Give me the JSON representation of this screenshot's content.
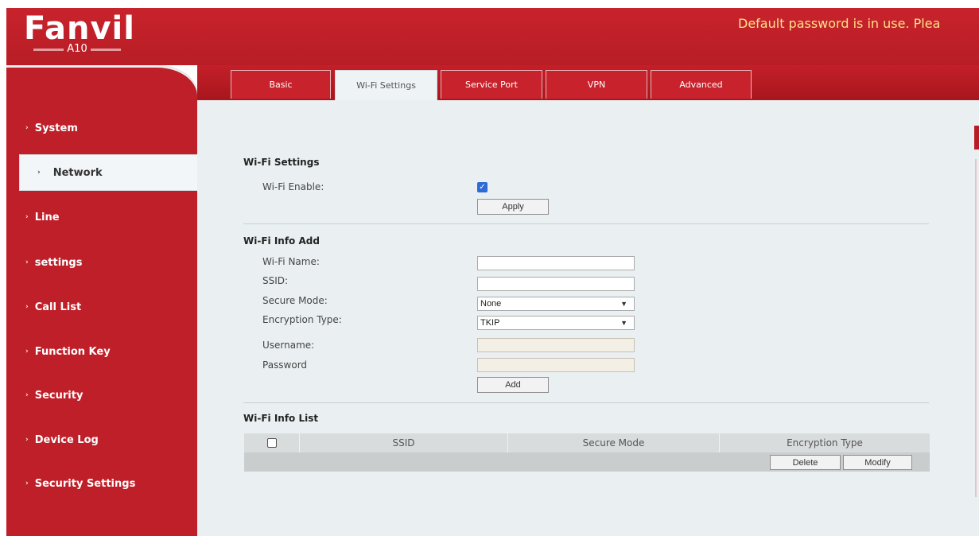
{
  "header": {
    "brand": "Fanvil",
    "model": "A10",
    "warning": "Default password is in use. Plea"
  },
  "sidebar": {
    "items": [
      {
        "label": "System"
      },
      {
        "label": "Network",
        "active": true
      },
      {
        "label": "Line"
      },
      {
        "label": "settings"
      },
      {
        "label": "Call List"
      },
      {
        "label": "Function Key"
      },
      {
        "label": "Security"
      },
      {
        "label": "Device Log"
      },
      {
        "label": "Security Settings"
      }
    ]
  },
  "tabs": [
    {
      "label": "Basic"
    },
    {
      "label": "Wi-Fi Settings",
      "active": true
    },
    {
      "label": "Service Port"
    },
    {
      "label": "VPN"
    },
    {
      "label": "Advanced"
    }
  ],
  "wifi_settings": {
    "title": "Wi-Fi Settings",
    "enable_label": "Wi-Fi Enable:",
    "enable_checked": true,
    "apply_label": "Apply"
  },
  "wifi_info_add": {
    "title": "Wi-Fi Info Add",
    "name_label": "Wi-Fi Name:",
    "name_value": "",
    "ssid_label": "SSID:",
    "ssid_value": "",
    "secure_mode_label": "Secure Mode:",
    "secure_mode_value": "None",
    "encryption_label": "Encryption Type:",
    "encryption_value": "TKIP",
    "username_label": "Username:",
    "username_value": "",
    "password_label": "Password",
    "password_value": "",
    "add_label": "Add"
  },
  "wifi_info_list": {
    "title": "Wi-Fi Info List",
    "columns": [
      "SSID",
      "Secure Mode",
      "Encryption Type"
    ],
    "delete_label": "Delete",
    "modify_label": "Modify"
  },
  "colors": {
    "brand_red": "#c8232c",
    "warning_text": "#ffe08a",
    "content_bg": "#eaf0f2"
  }
}
